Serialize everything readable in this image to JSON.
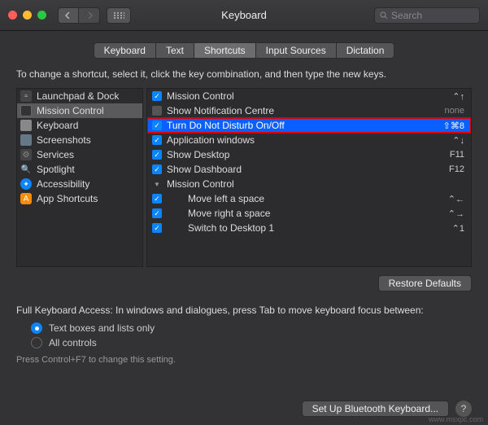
{
  "titlebar": {
    "title": "Keyboard",
    "search_placeholder": "Search"
  },
  "tabs": [
    {
      "label": "Keyboard",
      "active": false
    },
    {
      "label": "Text",
      "active": false
    },
    {
      "label": "Shortcuts",
      "active": true
    },
    {
      "label": "Input Sources",
      "active": false
    },
    {
      "label": "Dictation",
      "active": false
    }
  ],
  "instruction": "To change a shortcut, select it, click the key combination, and then type the new keys.",
  "categories": [
    {
      "label": "Launchpad & Dock",
      "icon": "launchpad",
      "selected": false
    },
    {
      "label": "Mission Control",
      "icon": "mission",
      "selected": true
    },
    {
      "label": "Keyboard",
      "icon": "keyboard",
      "selected": false
    },
    {
      "label": "Screenshots",
      "icon": "screenshots",
      "selected": false
    },
    {
      "label": "Services",
      "icon": "services",
      "selected": false
    },
    {
      "label": "Spotlight",
      "icon": "spotlight",
      "selected": false
    },
    {
      "label": "Accessibility",
      "icon": "accessibility",
      "selected": false
    },
    {
      "label": "App Shortcuts",
      "icon": "appshortcuts",
      "selected": false
    }
  ],
  "shortcuts": [
    {
      "checked": true,
      "label": "Mission Control",
      "keys": "⌃↑",
      "highlighted": false,
      "indent": 0
    },
    {
      "checked": false,
      "label": "Show Notification Centre",
      "keys": "none",
      "highlighted": false,
      "indent": 0,
      "keysDim": true
    },
    {
      "checked": true,
      "label": "Turn Do Not Disturb On/Off",
      "keys": "⇧⌘8",
      "highlighted": true,
      "indent": 0
    },
    {
      "checked": true,
      "label": "Application windows",
      "keys": "⌃↓",
      "highlighted": false,
      "indent": 0
    },
    {
      "checked": true,
      "label": "Show Desktop",
      "keys": "F11",
      "highlighted": false,
      "indent": 0
    },
    {
      "checked": true,
      "label": "Show Dashboard",
      "keys": "F12",
      "highlighted": false,
      "indent": 0
    },
    {
      "checked": null,
      "label": "Mission Control",
      "keys": "",
      "highlighted": false,
      "indent": 0,
      "group": true
    },
    {
      "checked": true,
      "label": "Move left a space",
      "keys": "⌃←",
      "highlighted": false,
      "indent": 1
    },
    {
      "checked": true,
      "label": "Move right a space",
      "keys": "⌃→",
      "highlighted": false,
      "indent": 1
    },
    {
      "checked": true,
      "label": "Switch to Desktop 1",
      "keys": "⌃1",
      "highlighted": false,
      "indent": 1
    }
  ],
  "buttons": {
    "restore": "Restore Defaults",
    "bluetooth": "Set Up Bluetooth Keyboard...",
    "help": "?"
  },
  "fullKeyboardAccess": {
    "intro": "Full Keyboard Access: In windows and dialogues, press Tab to move keyboard focus between:",
    "opt1": "Text boxes and lists only",
    "opt2": "All controls",
    "hint": "Press Control+F7 to change this setting."
  },
  "watermark": "www.msxpc.com"
}
